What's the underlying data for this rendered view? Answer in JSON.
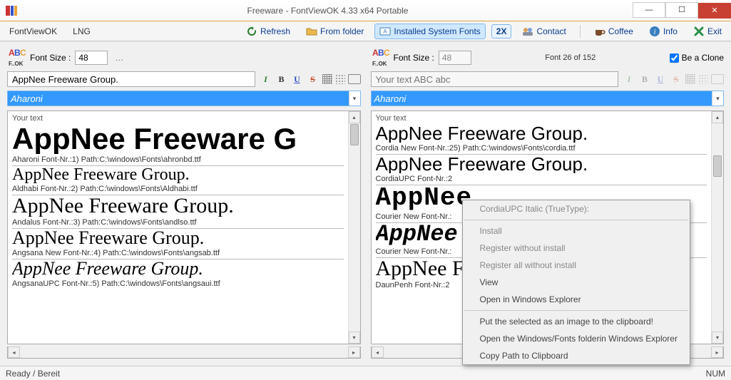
{
  "window": {
    "title": "Freeware - FontViewOK 4.33 x64 Portable"
  },
  "menubar": {
    "app": "FontViewOK",
    "lng": "LNG"
  },
  "toolbar": {
    "refresh": "Refresh",
    "from_folder": "From folder",
    "installed": "Installed System Fonts",
    "two_x": "2X",
    "contact": "Contact",
    "coffee": "Coffee",
    "info": "Info",
    "exit": "Exit"
  },
  "left": {
    "size_label": "Font Size :",
    "size_value": "48",
    "text_value": "AppNee Freeware Group.",
    "font_selected": "Aharoni",
    "your_text": "Your text",
    "items": [
      {
        "sample": "AppNee Freeware G",
        "meta": "Aharoni Font-Nr.:1) Path:C:\\windows\\Fonts\\ahronbd.ttf",
        "css": "font-family:Arial Black,Impact,sans-serif;font-weight:900;font-size:42px;"
      },
      {
        "sample": "AppNee Freeware Group.",
        "meta": "Aldhabi Font-Nr.:2) Path:C:\\windows\\Fonts\\Aldhabi.ttf",
        "css": "font-family:'Times New Roman',serif;font-size:24px;"
      },
      {
        "sample": "AppNee Freeware Group.",
        "meta": "Andalus Font-Nr.:3) Path:C:\\windows\\Fonts\\andlso.ttf",
        "css": "font-family:Georgia,'Times New Roman',serif;font-size:30px;"
      },
      {
        "sample": "AppNee Freeware Group.",
        "meta": "Angsana New Font-Nr.:4) Path:C:\\windows\\Fonts\\angsab.ttf",
        "css": "font-family:'Times New Roman',serif;font-size:26px;"
      },
      {
        "sample": "AppNee Freeware Group.",
        "meta": "AngsanaUPC Font-Nr.:5) Path:C:\\windows\\Fonts\\angsaui.ttf",
        "css": "font-family:'Times New Roman',serif;font-style:italic;font-size:26px;"
      }
    ]
  },
  "right": {
    "size_label": "Font Size :",
    "size_value": "48",
    "count_label": "Font 26 of 152",
    "clone_label": "Be a Clone",
    "text_placeholder": "Your text ABC abc",
    "font_selected": "Aharoni",
    "your_text": "Your text",
    "items": [
      {
        "sample": "AppNee Freeware Group.",
        "meta": "Cordia New Font-Nr.:25) Path:C:\\windows\\Fonts\\cordia.ttf",
        "css": "font-family:Tahoma,Arial,sans-serif;font-size:26px;font-weight:300;"
      },
      {
        "sample": "AppNee Freeware Group.",
        "meta": "CordiaUPC Font-Nr.:2",
        "css": "font-family:Tahoma,Arial,sans-serif;font-size:26px;font-weight:300;"
      },
      {
        "sample": "AppNee",
        "meta": "Courier New Font-Nr.:",
        "css": "font-family:'Courier New',monospace;font-weight:bold;font-size:36px;letter-spacing:1px;"
      },
      {
        "sample": "AppNee F",
        "meta": "Courier New Font-Nr.:",
        "css": "font-family:'Courier New',monospace;font-style:italic;font-weight:bold;font-size:32px;"
      },
      {
        "sample": "AppNee F",
        "meta": "DaunPenh Font-Nr.:2",
        "css": "font-family:Georgia,serif;font-size:30px;"
      }
    ]
  },
  "context_menu": {
    "header": "CordiaUPC Italic (TrueType):",
    "install": "Install",
    "reg_no_install": "Register without install",
    "reg_all_no_install": "Register all without install",
    "view": "View",
    "open_explorer": "Open in Windows Explorer",
    "put_clip": "Put the selected as an image to the clipboard!",
    "open_fonts_folder": "Open the Windows/Fonts folderin  Windows Explorer",
    "copy_path": "Copy Path to Clipboard"
  },
  "status": {
    "ready": "Ready / Bereit",
    "num": "NUM"
  }
}
